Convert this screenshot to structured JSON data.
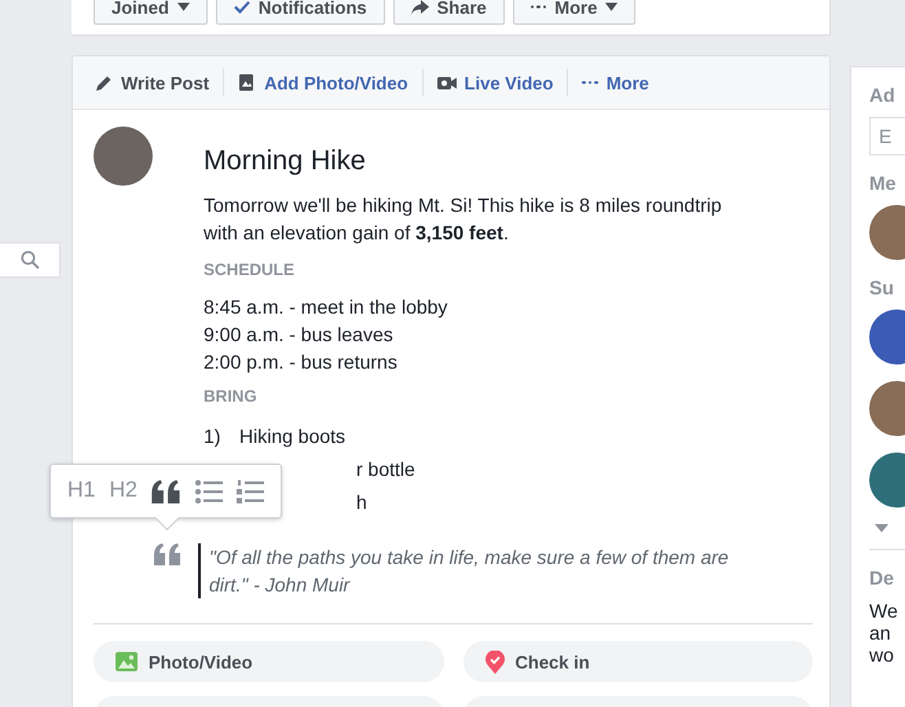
{
  "group_actions": [
    {
      "kind": "dropdown",
      "label": "Joined"
    },
    {
      "kind": "check",
      "label": "Notifications"
    },
    {
      "kind": "share",
      "label": "Share"
    },
    {
      "kind": "more",
      "label": "More"
    }
  ],
  "composer_tabs": [
    {
      "kind": "pencil",
      "label": "Write Post",
      "selected": true
    },
    {
      "kind": "photo",
      "label": "Add Photo/Video",
      "selected": false
    },
    {
      "kind": "live",
      "label": "Live Video",
      "selected": false
    },
    {
      "kind": "dots",
      "label": "More",
      "selected": false
    }
  ],
  "post": {
    "title": "Morning Hike",
    "intro": "Tomorrow we'll be hiking Mt. Si! This hike is 8 miles roundtrip with an elevation gain of **3,150 feet**.",
    "sections": [
      {
        "heading": "SCHEDULE",
        "kind": "lines",
        "items": [
          {
            "text": "8:45 a.m. - meet in the lobby"
          },
          {
            "text": "9:00 a.m. - bus leaves"
          },
          {
            "text": "2:00 p.m. - bus returns"
          }
        ]
      },
      {
        "heading": "BRING",
        "kind": "numbered",
        "items": [
          {
            "kind": "full",
            "number": "1)",
            "text": "Hiking boots"
          },
          {
            "kind": "partial",
            "text": "r bottle"
          },
          {
            "kind": "partial",
            "text": "h"
          }
        ]
      }
    ],
    "quote": "\"Of all the paths you take in life, make sure a few of them are dirt.\" - John Muir"
  },
  "format_toolbar": [
    {
      "kind": "text",
      "label": "H1",
      "active": false
    },
    {
      "kind": "text",
      "label": "H2",
      "active": false
    },
    {
      "kind": "quote",
      "active": true
    },
    {
      "kind": "bullets",
      "active": false
    },
    {
      "kind": "numbers",
      "active": false
    }
  ],
  "attach_buttons": [
    {
      "kind": "photo",
      "label": "Photo/Video"
    },
    {
      "kind": "checkin",
      "label": "Check in"
    }
  ],
  "right_column": {
    "heading_1": "Ad",
    "field_placeholder": "E",
    "heading_2": "Me",
    "heading_3": "Su",
    "heading_4": "De",
    "text_lines": [
      "We",
      "an",
      "wo"
    ]
  }
}
